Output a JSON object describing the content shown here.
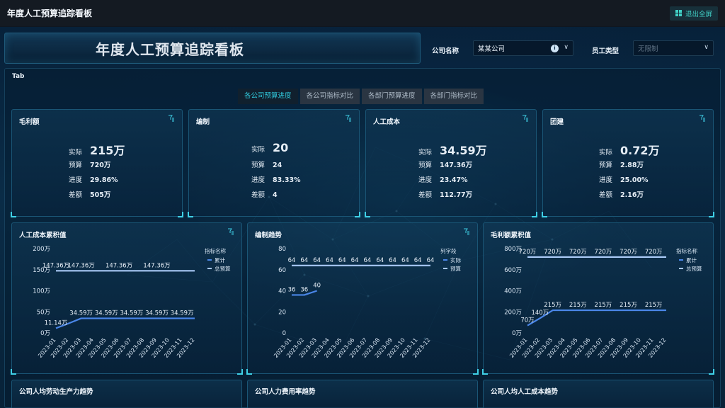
{
  "topbar": {
    "title": "年度人工预算追踪看板",
    "exit_label": "退出全屏"
  },
  "banner": {
    "title": "年度人工预算追踪看板"
  },
  "filters": {
    "company_label": "公司名称",
    "company_value": "某某公司",
    "employee_label": "员工类型",
    "employee_placeholder": "无限制"
  },
  "tab_panel": {
    "label": "Tab",
    "tabs": [
      "各公司预算进度",
      "各公司指标对比",
      "各部门预算进度",
      "各部门指标对比"
    ],
    "active_tab": 0
  },
  "kpis": [
    {
      "title": "毛利额",
      "actual_label": "实际",
      "actual": "215万",
      "budget_label": "预算",
      "budget": "720万",
      "progress_label": "进度",
      "progress": "29.86%",
      "diff_label": "差额",
      "diff": "505万"
    },
    {
      "title": "编制",
      "actual_label": "实际",
      "actual": "20",
      "budget_label": "预算",
      "budget": "24",
      "progress_label": "进度",
      "progress": "83.33%",
      "diff_label": "差额",
      "diff": "4"
    },
    {
      "title": "人工成本",
      "actual_label": "实际",
      "actual": "34.59万",
      "budget_label": "预算",
      "budget": "147.36万",
      "progress_label": "进度",
      "progress": "23.47%",
      "diff_label": "差额",
      "diff": "112.77万"
    },
    {
      "title": "团建",
      "actual_label": "实际",
      "actual": "0.72万",
      "budget_label": "预算",
      "budget": "2.88万",
      "progress_label": "进度",
      "progress": "25.00%",
      "diff_label": "差额",
      "diff": "2.16万"
    }
  ],
  "chart_data": [
    {
      "type": "line",
      "title": "人工成本累积值",
      "x": [
        "2023-01",
        "2023-02",
        "2023-03",
        "2023-04",
        "2023-05",
        "2023-06",
        "2023-07",
        "2023-08",
        "2023-09",
        "2023-10",
        "2023-11",
        "2023-12"
      ],
      "yticks": [
        "200万",
        "150万",
        "100万",
        "50万",
        "0万"
      ],
      "ylim": [
        0,
        200
      ],
      "legend_title": "指标名称",
      "series": [
        {
          "name": "累计",
          "color": "#4a86e8",
          "values": [
            11.14,
            22.5,
            34.59,
            34.59,
            34.59,
            34.59,
            34.59,
            34.59,
            34.59,
            34.59,
            34.59,
            34.59
          ],
          "labels": [
            {
              "i": 0,
              "text": "11.14万"
            },
            {
              "i": 2,
              "text": "34.59万"
            },
            {
              "i": 4,
              "text": "34.59万"
            },
            {
              "i": 6,
              "text": "34.59万"
            },
            {
              "i": 8,
              "text": "34.59万"
            },
            {
              "i": 10,
              "text": "34.59万"
            }
          ]
        },
        {
          "name": "总预算",
          "color": "#a8c8f5",
          "values": [
            147.36,
            147.36,
            147.36,
            147.36,
            147.36,
            147.36,
            147.36,
            147.36,
            147.36,
            147.36,
            147.36,
            147.36
          ],
          "labels": [
            {
              "i": 0,
              "text": "147.36万"
            },
            {
              "i": 2,
              "text": "147.36万"
            },
            {
              "i": 5,
              "text": "147.36万"
            },
            {
              "i": 8,
              "text": "147.36万"
            }
          ]
        }
      ]
    },
    {
      "type": "line",
      "title": "编制趋势",
      "x": [
        "2023-01",
        "2023-02",
        "2023-03",
        "2023-04",
        "2023-05",
        "2023-06",
        "2023-07",
        "2023-08",
        "2023-09",
        "2023-10",
        "2023-11",
        "2023-12"
      ],
      "yticks": [
        "80",
        "60",
        "40",
        "20",
        "0"
      ],
      "ylim": [
        0,
        80
      ],
      "legend_title": "列字段",
      "series": [
        {
          "name": "实际",
          "color": "#4a86e8",
          "values": [
            36,
            36,
            40
          ],
          "labels": [
            {
              "i": 0,
              "text": "36"
            },
            {
              "i": 1,
              "text": "36"
            },
            {
              "i": 2,
              "text": "40"
            }
          ]
        },
        {
          "name": "预算",
          "color": "#a8c8f5",
          "values": [
            64,
            64,
            64,
            64,
            64,
            64,
            64,
            64,
            64,
            64,
            64,
            64
          ],
          "labels": [
            {
              "i": 0,
              "text": "64"
            },
            {
              "i": 1,
              "text": "64"
            },
            {
              "i": 2,
              "text": "64"
            },
            {
              "i": 3,
              "text": "64"
            },
            {
              "i": 4,
              "text": "64"
            },
            {
              "i": 5,
              "text": "64"
            },
            {
              "i": 6,
              "text": "64"
            },
            {
              "i": 7,
              "text": "64"
            },
            {
              "i": 8,
              "text": "64"
            },
            {
              "i": 9,
              "text": "64"
            },
            {
              "i": 10,
              "text": "64"
            },
            {
              "i": 11,
              "text": "64"
            }
          ]
        }
      ]
    },
    {
      "type": "line",
      "title": "毛利额累积值",
      "x": [
        "2023-01",
        "2023-02",
        "2023-03",
        "2023-04",
        "2023-05",
        "2023-06",
        "2023-07",
        "2023-08",
        "2023-09",
        "2023-10",
        "2023-11",
        "2023-12"
      ],
      "yticks": [
        "800万",
        "600万",
        "400万",
        "200万",
        "0万"
      ],
      "ylim": [
        0,
        800
      ],
      "legend_title": "指标名称",
      "series": [
        {
          "name": "累计",
          "color": "#4a86e8",
          "values": [
            70,
            140,
            215,
            215,
            215,
            215,
            215,
            215,
            215,
            215,
            215,
            215
          ],
          "labels": [
            {
              "i": 0,
              "text": "70万"
            },
            {
              "i": 1,
              "text": "140万"
            },
            {
              "i": 2,
              "text": "215万"
            },
            {
              "i": 4,
              "text": "215万"
            },
            {
              "i": 6,
              "text": "215万"
            },
            {
              "i": 8,
              "text": "215万"
            },
            {
              "i": 10,
              "text": "215万"
            }
          ]
        },
        {
          "name": "总预算",
          "color": "#a8c8f5",
          "values": [
            720,
            720,
            720,
            720,
            720,
            720,
            720,
            720,
            720,
            720,
            720,
            720
          ],
          "labels": [
            {
              "i": 0,
              "text": "720万"
            },
            {
              "i": 2,
              "text": "720万"
            },
            {
              "i": 4,
              "text": "720万"
            },
            {
              "i": 6,
              "text": "720万"
            },
            {
              "i": 8,
              "text": "720万"
            },
            {
              "i": 10,
              "text": "720万"
            }
          ]
        }
      ]
    }
  ],
  "bottom_cards": [
    "公司人均劳动生产力趋势",
    "公司人力费用率趋势",
    "公司人均人工成本趋势"
  ]
}
